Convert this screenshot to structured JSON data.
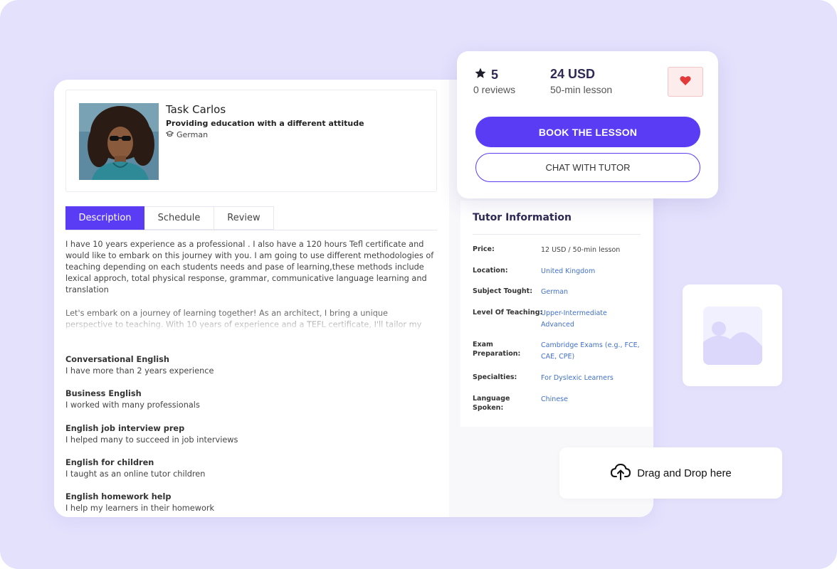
{
  "profile": {
    "name": "Task Carlos",
    "tagline": "Providing education with a different attitude",
    "language": "German"
  },
  "tabs": [
    {
      "label": "Description"
    },
    {
      "label": "Schedule"
    },
    {
      "label": "Review"
    }
  ],
  "description": {
    "paragraph1": "I have 10 years experience as a professional . I also have a 120 hours Tefl certificate and would like to embark on this journey with you. I am going to use different methodologies of teaching depending on each students needs and pase of learning,these methods include lexical approch, total physical response, grammar, communicative language learning and translation",
    "paragraph2": "Let's embark on a journey of learning together! As an architect, I bring a unique perspective to teaching. With 10 years of experience and a TEFL certificate, I'll tailor my approach to meet"
  },
  "skills": [
    {
      "title": "Conversational English",
      "subtitle": "I have more than 2 years experience"
    },
    {
      "title": "Business English",
      "subtitle": "I worked with many professionals"
    },
    {
      "title": "English job interview prep",
      "subtitle": "I helped many to succeed in job interviews"
    },
    {
      "title": "English for children",
      "subtitle": "I taught as an online tutor children"
    },
    {
      "title": "English homework help",
      "subtitle": "I help my learners in their homework"
    }
  ],
  "tutor_info": {
    "title": "Tutor Information",
    "rows": [
      {
        "key": "Price:",
        "value": "12 USD / 50-min lesson"
      },
      {
        "key": "Location:",
        "value": "United Kingdom"
      },
      {
        "key": "Subject Tought:",
        "value": "German"
      },
      {
        "key": "Level Of Teaching:",
        "value": "Upper-Intermediate Advanced"
      },
      {
        "key": "Exam Preparation:",
        "value": "Cambridge Exams (e.g., FCE, CAE, CPE)"
      },
      {
        "key": "Specialties:",
        "value": "For Dyslexic Learners"
      },
      {
        "key": "Language Spoken:",
        "value": "Chinese"
      }
    ]
  },
  "booking": {
    "rating": "5",
    "reviews": "0 reviews",
    "price": "24 USD",
    "price_sub": "50-min lesson",
    "book_label": "BOOK THE LESSON",
    "chat_label": "CHAT WITH TUTOR"
  },
  "upload": {
    "label": "Drag and Drop here"
  },
  "icons": {
    "rating": "star-icon",
    "favorite": "heart-icon",
    "language": "graduation-cap-icon",
    "image_placeholder": "image-icon",
    "upload": "cloud-upload-icon"
  },
  "colors": {
    "background": "#e4e1fd",
    "accent": "#5b3cf5",
    "heading": "#2e2a55",
    "link": "#4170c7",
    "heart": "#e23a3a"
  }
}
